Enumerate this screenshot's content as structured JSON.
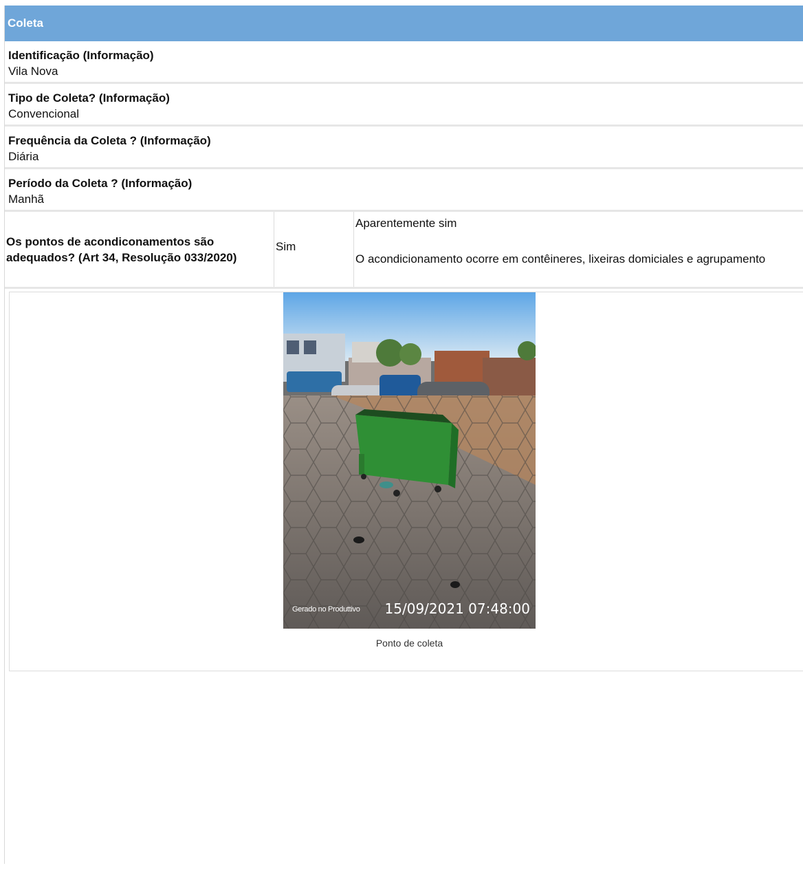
{
  "section": {
    "title": "Coleta"
  },
  "fields": [
    {
      "label": "Identificação (Informação)",
      "value": "Vila Nova"
    },
    {
      "label": "Tipo de Coleta? (Informação)",
      "value": "Convencional"
    },
    {
      "label": "Frequência da Coleta ? (Informação)",
      "value": "Diária"
    },
    {
      "label": "Período da Coleta ? (Informação)",
      "value": "Manhã"
    }
  ],
  "question": {
    "label": "Os pontos de acondiconamentos são adequados? (Art 34, Resolução 033/2020)",
    "answer": "Sim",
    "observation_title": "Aparentemente sim",
    "observation_text": "O acondicionamento ocorre em contêineres, lixeiras domiciales e agrupamento"
  },
  "photo": {
    "stamp_app": "Gerado no Produttivo",
    "stamp_datetime": "15/09/2021 07:48:00",
    "caption": "Ponto de coleta"
  }
}
